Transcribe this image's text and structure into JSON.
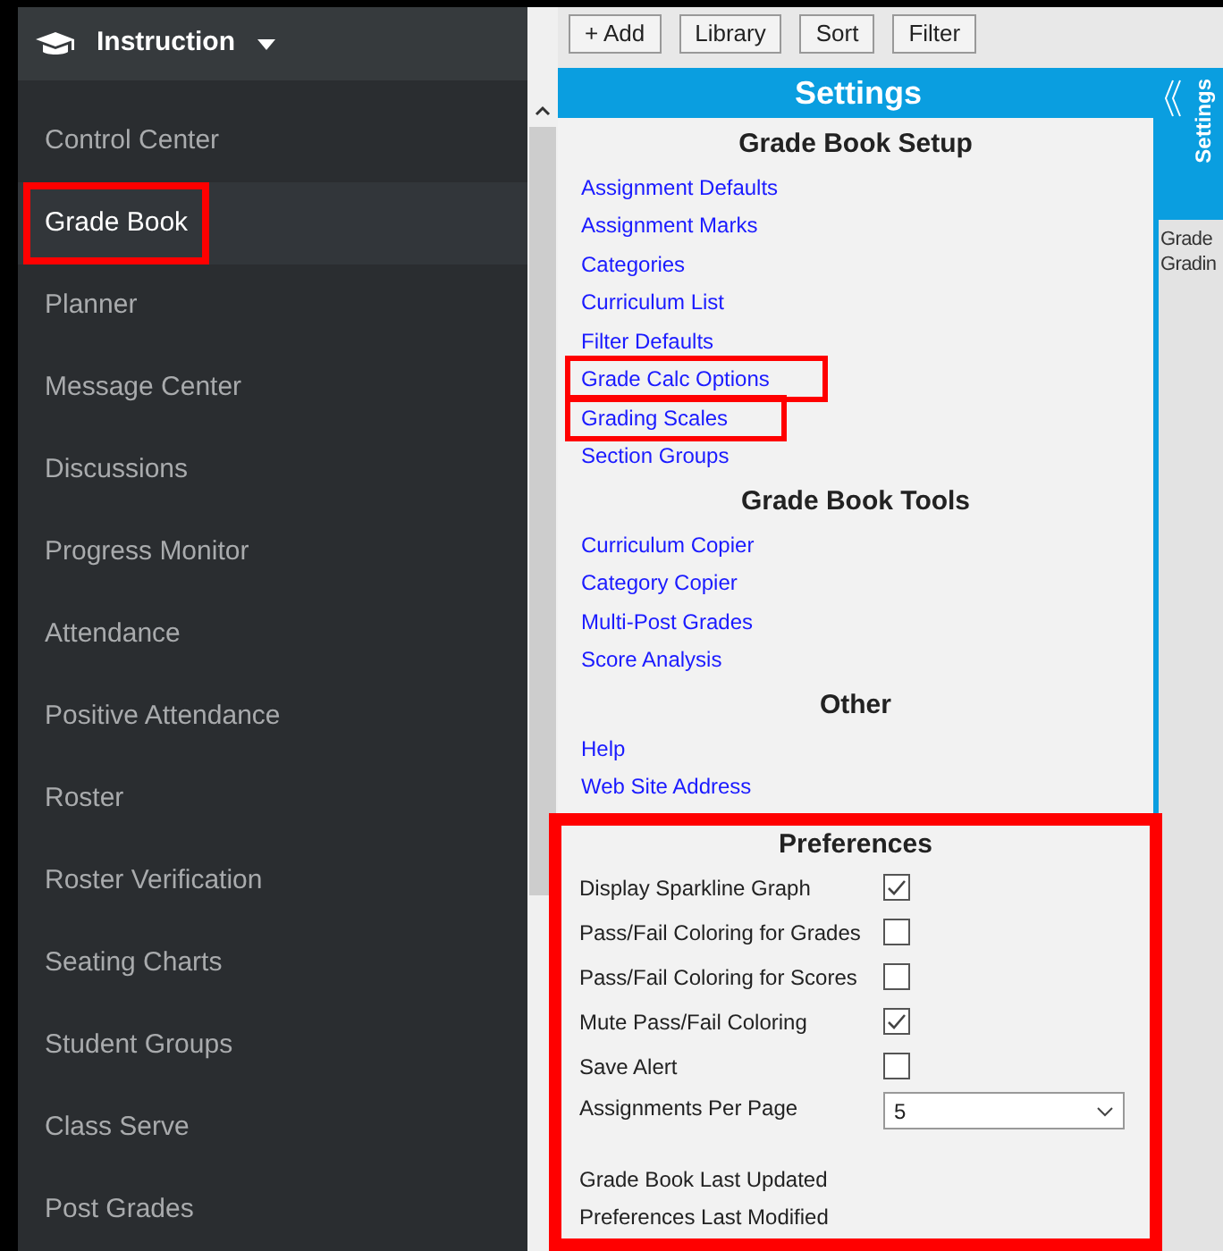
{
  "sidebar": {
    "title": "Instruction",
    "items": [
      {
        "label": "Control Center",
        "selected": false,
        "highlighted": false
      },
      {
        "label": "Grade Book",
        "selected": true,
        "highlighted": true
      },
      {
        "label": "Planner",
        "selected": false,
        "highlighted": false
      },
      {
        "label": "Message Center",
        "selected": false,
        "highlighted": false
      },
      {
        "label": "Discussions",
        "selected": false,
        "highlighted": false
      },
      {
        "label": "Progress Monitor",
        "selected": false,
        "highlighted": false
      },
      {
        "label": "Attendance",
        "selected": false,
        "highlighted": false
      },
      {
        "label": "Positive Attendance",
        "selected": false,
        "highlighted": false
      },
      {
        "label": "Roster",
        "selected": false,
        "highlighted": false
      },
      {
        "label": "Roster Verification",
        "selected": false,
        "highlighted": false
      },
      {
        "label": "Seating Charts",
        "selected": false,
        "highlighted": false
      },
      {
        "label": "Student Groups",
        "selected": false,
        "highlighted": false
      },
      {
        "label": "Class Serve",
        "selected": false,
        "highlighted": false
      },
      {
        "label": "Post Grades",
        "selected": false,
        "highlighted": false
      }
    ]
  },
  "toolbar": [
    "+ Add",
    "Library",
    "Sort",
    "Filter"
  ],
  "settings": {
    "title": "Settings",
    "sections": [
      {
        "heading": "Grade Book Setup",
        "links": [
          {
            "label": "Assignment Defaults",
            "highlighted": false
          },
          {
            "label": "Assignment Marks",
            "highlighted": false
          },
          {
            "label": "Categories",
            "highlighted": false
          },
          {
            "label": "Curriculum List",
            "highlighted": false
          },
          {
            "label": "Filter Defaults",
            "highlighted": false
          },
          {
            "label": "Grade Calc Options",
            "highlighted": true
          },
          {
            "label": "Grading Scales",
            "highlighted": true
          },
          {
            "label": "Section Groups",
            "highlighted": false
          }
        ]
      },
      {
        "heading": "Grade Book Tools",
        "links": [
          {
            "label": "Curriculum Copier",
            "highlighted": false
          },
          {
            "label": "Category Copier",
            "highlighted": false
          },
          {
            "label": "Multi-Post Grades",
            "highlighted": false
          },
          {
            "label": "Score Analysis",
            "highlighted": false
          }
        ]
      },
      {
        "heading": "Other",
        "links": [
          {
            "label": "Help",
            "highlighted": false
          },
          {
            "label": "Web Site Address",
            "highlighted": false
          }
        ]
      }
    ],
    "preferences": {
      "heading": "Preferences",
      "highlighted": true,
      "rows": [
        {
          "kind": "checkbox",
          "label": "Display Sparkline Graph",
          "checked": true
        },
        {
          "kind": "checkbox",
          "label": "Pass/Fail Coloring for Grades",
          "checked": false
        },
        {
          "kind": "checkbox",
          "label": "Pass/Fail Coloring for Scores",
          "checked": false
        },
        {
          "kind": "checkbox",
          "label": "Mute Pass/Fail Coloring",
          "checked": true
        },
        {
          "kind": "checkbox",
          "label": "Save Alert",
          "checked": false
        },
        {
          "kind": "select",
          "label": "Assignments Per Page",
          "value": "5"
        },
        {
          "kind": "text",
          "label": "Grade Book Last Updated"
        },
        {
          "kind": "text",
          "label": "Preferences Last Modified"
        }
      ]
    }
  },
  "side_panel": {
    "title": "Settings",
    "lines": [
      "Grade",
      "Gradin"
    ]
  }
}
